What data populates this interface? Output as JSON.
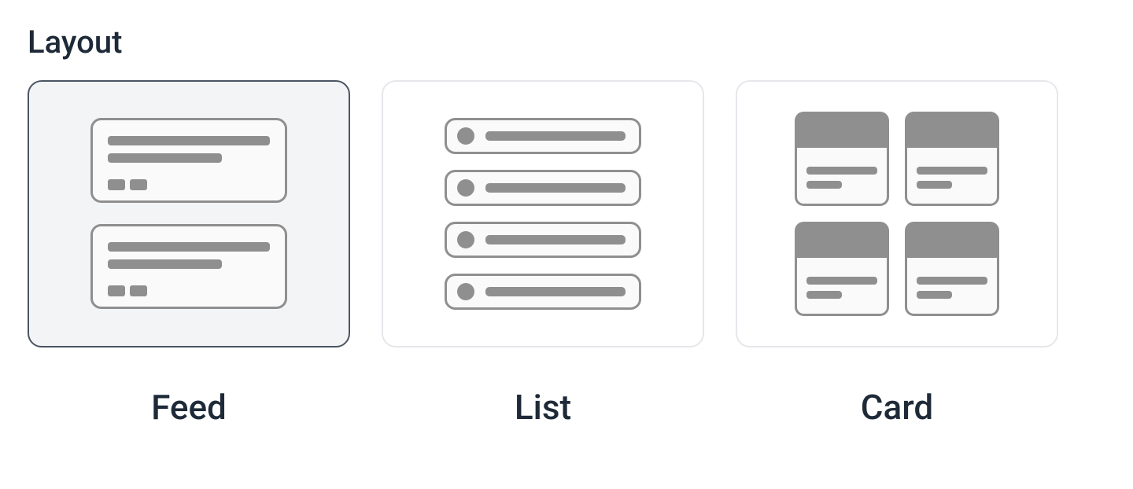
{
  "section_title": "Layout",
  "options": [
    {
      "label": "Feed",
      "selected": true
    },
    {
      "label": "List",
      "selected": false
    },
    {
      "label": "Card",
      "selected": false
    }
  ],
  "colors": {
    "text": "#1e2a38",
    "selected_border": "#4b5563",
    "selected_bg": "#f3f4f6",
    "unselected_border": "#e5e7eb",
    "icon_gray": "#8f8f8f",
    "icon_fill_light": "#fafafa"
  }
}
